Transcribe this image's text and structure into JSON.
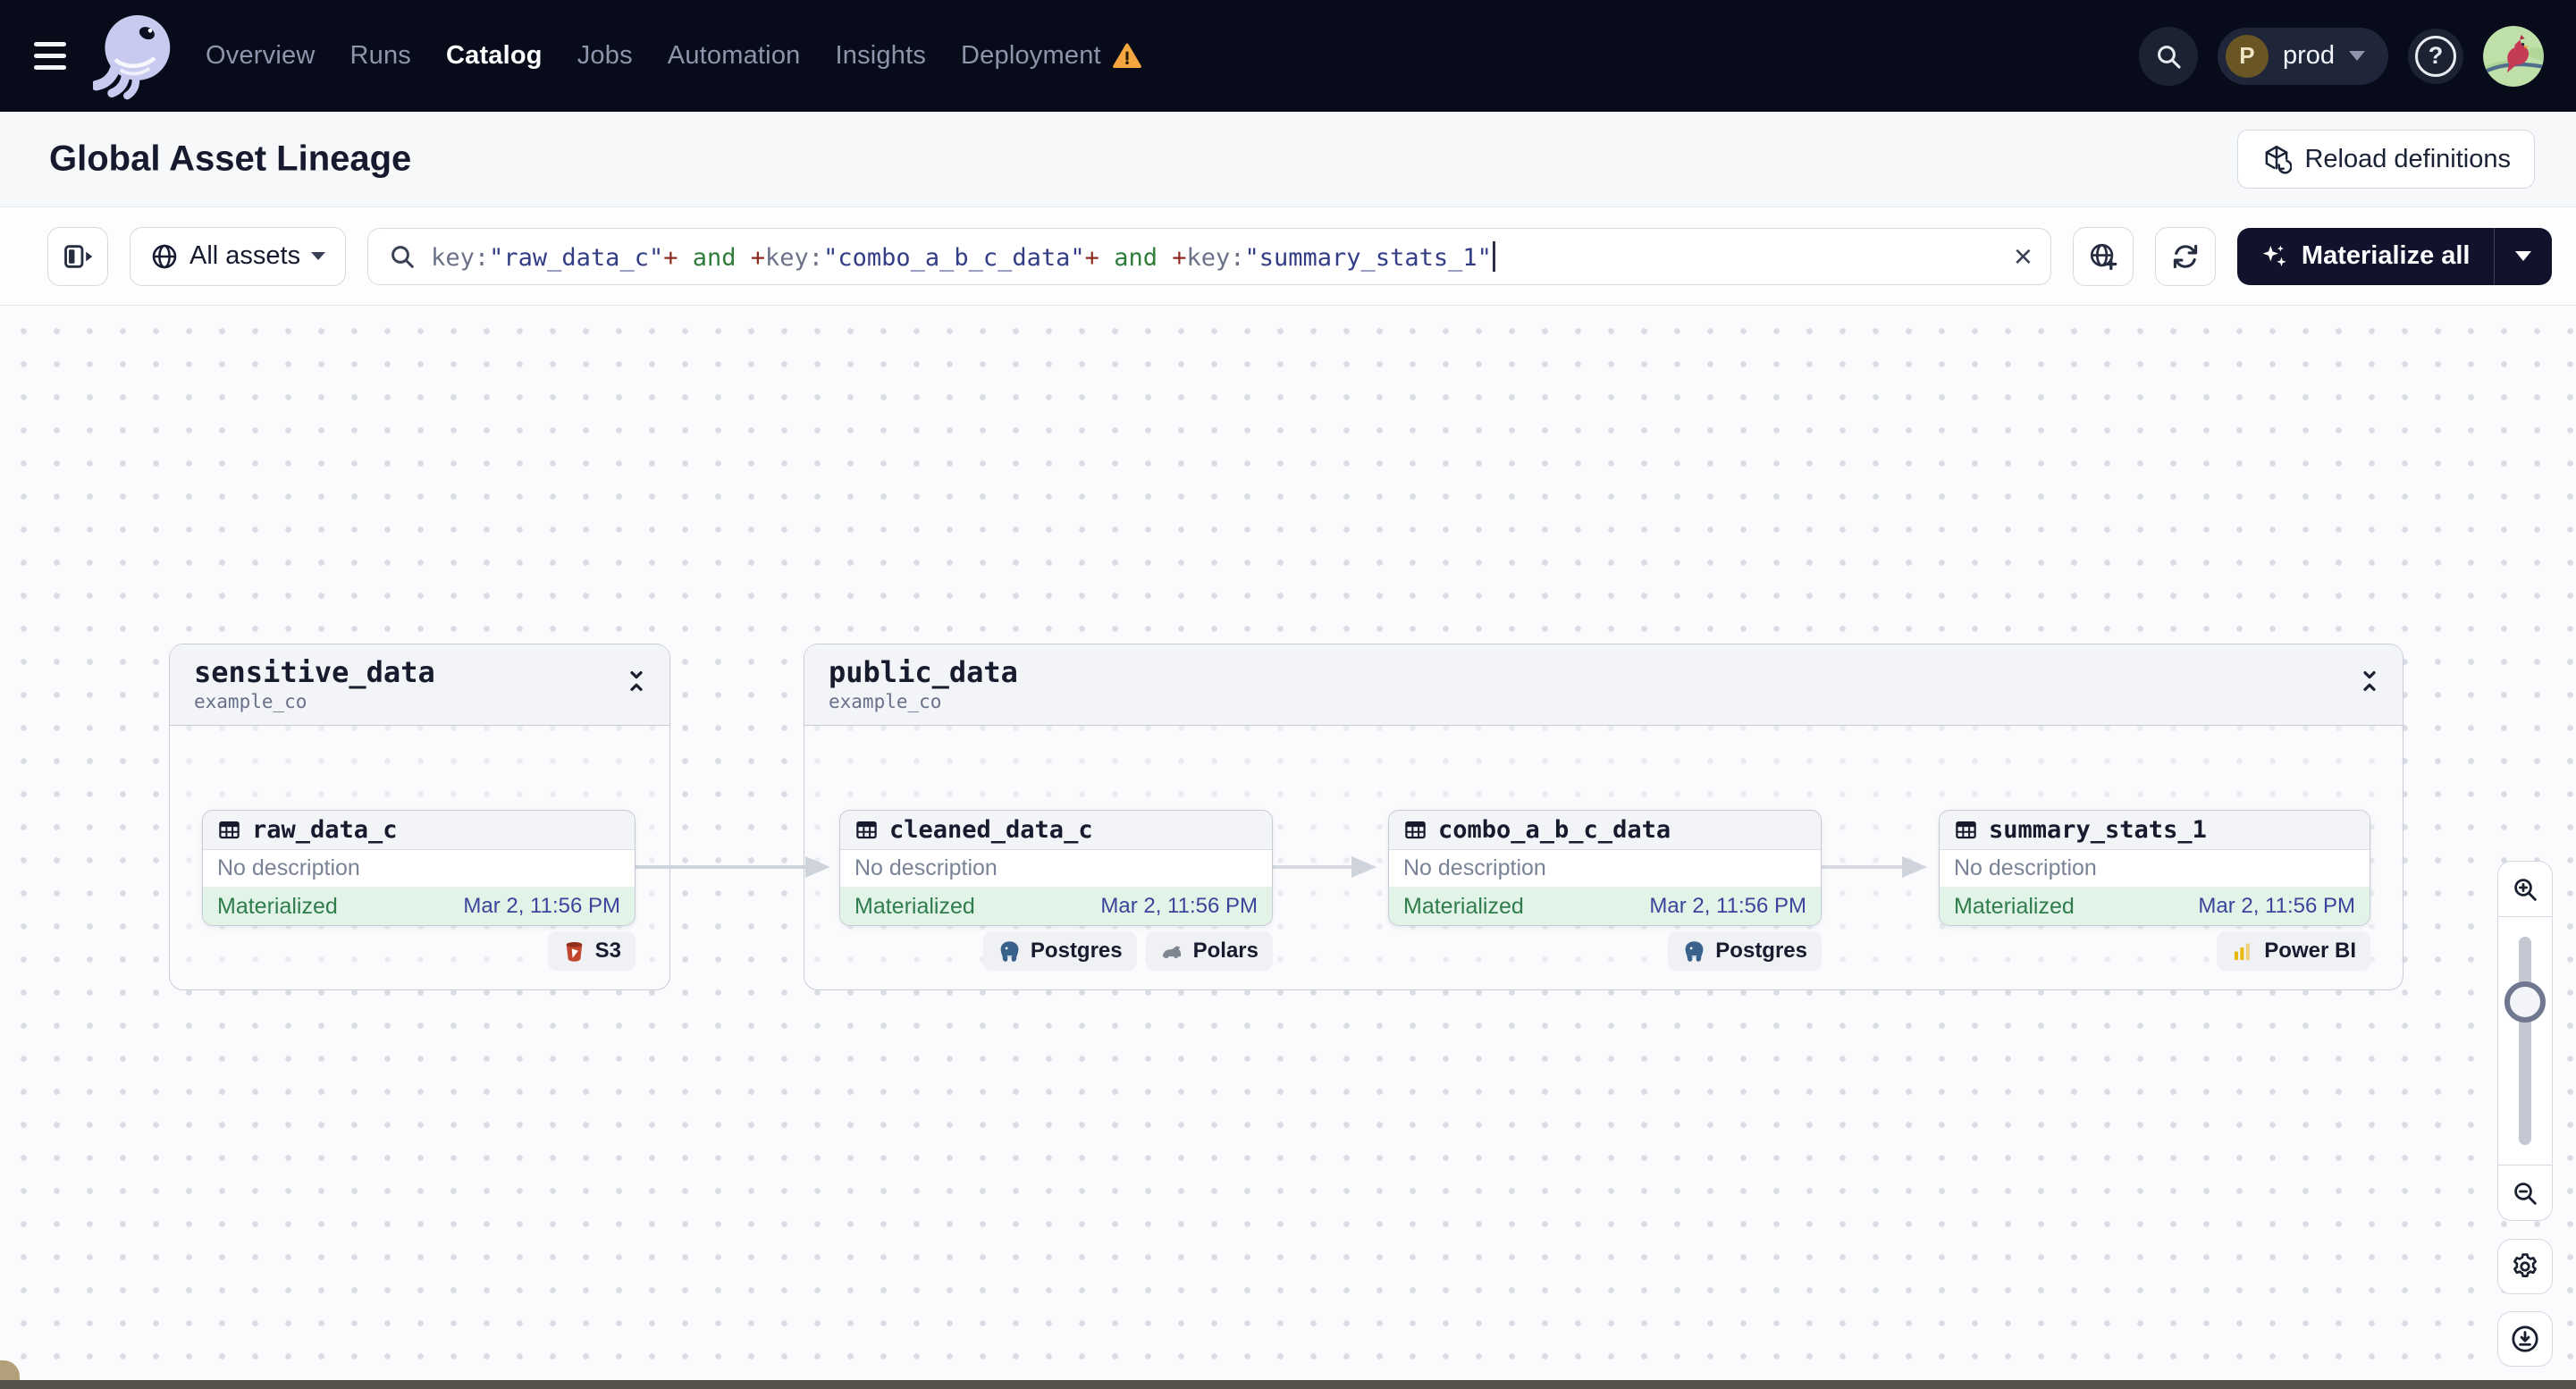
{
  "theme": {
    "nav_bg": "#070B1A",
    "dark_btn": "#10132B",
    "q_key": "#6B7287",
    "q_str": "#333D85",
    "q_op": "#8F2A1E",
    "q_and": "#2F7D3B",
    "status_bg": "#E2F3E8",
    "status_fg": "#2F7D4C",
    "date_fg": "#3A459C",
    "warning": "#F5A640",
    "edge": "#CFD3DC"
  },
  "nav": {
    "menu_items": [
      {
        "label": "Overview"
      },
      {
        "label": "Runs"
      },
      {
        "label": "Catalog"
      },
      {
        "label": "Jobs"
      },
      {
        "label": "Automation"
      },
      {
        "label": "Insights"
      },
      {
        "label": "Deployment"
      }
    ],
    "active_item": "Catalog",
    "environment": {
      "initial": "P",
      "label": "prod"
    }
  },
  "page_header": {
    "title": "Global Asset Lineage",
    "reload_button": "Reload definitions"
  },
  "toolbar": {
    "scope": {
      "label": "All assets"
    },
    "search": {
      "segments": [
        {
          "kind": "key",
          "text": "key:"
        },
        {
          "kind": "string",
          "text": "\"raw_data_c\""
        },
        {
          "kind": "op",
          "text": "+"
        },
        {
          "kind": "logic",
          "text": " and "
        },
        {
          "kind": "op",
          "text": "+"
        },
        {
          "kind": "key",
          "text": "key:"
        },
        {
          "kind": "string",
          "text": "\"combo_a_b_c_data\""
        },
        {
          "kind": "op",
          "text": "+"
        },
        {
          "kind": "logic",
          "text": " and "
        },
        {
          "kind": "op",
          "text": "+"
        },
        {
          "kind": "key",
          "text": "key:"
        },
        {
          "kind": "string",
          "text": "\"summary_stats_1\""
        }
      ],
      "clear_glyph": "×"
    },
    "materialize": {
      "label": "Materialize all"
    }
  },
  "graph": {
    "groups": [
      {
        "title": "sensitive_data",
        "subtitle": "example_co"
      },
      {
        "title": "public_data",
        "subtitle": "example_co"
      }
    ],
    "nodes": [
      {
        "name": "raw_data_c",
        "description": "No description",
        "status": "Materialized",
        "timestamp": "Mar 2, 11:56 PM",
        "badges": [
          {
            "label": "S3",
            "icon": "s3-icon"
          }
        ]
      },
      {
        "name": "cleaned_data_c",
        "description": "No description",
        "status": "Materialized",
        "timestamp": "Mar 2, 11:56 PM",
        "badges": [
          {
            "label": "Postgres",
            "icon": "postgres-icon"
          },
          {
            "label": "Polars",
            "icon": "polars-icon"
          }
        ]
      },
      {
        "name": "combo_a_b_c_data",
        "description": "No description",
        "status": "Materialized",
        "timestamp": "Mar 2, 11:56 PM",
        "badges": [
          {
            "label": "Postgres",
            "icon": "postgres-icon"
          }
        ]
      },
      {
        "name": "summary_stats_1",
        "description": "No description",
        "status": "Materialized",
        "timestamp": "Mar 2, 11:56 PM",
        "badges": [
          {
            "label": "Power BI",
            "icon": "powerbi-icon"
          }
        ]
      }
    ]
  }
}
